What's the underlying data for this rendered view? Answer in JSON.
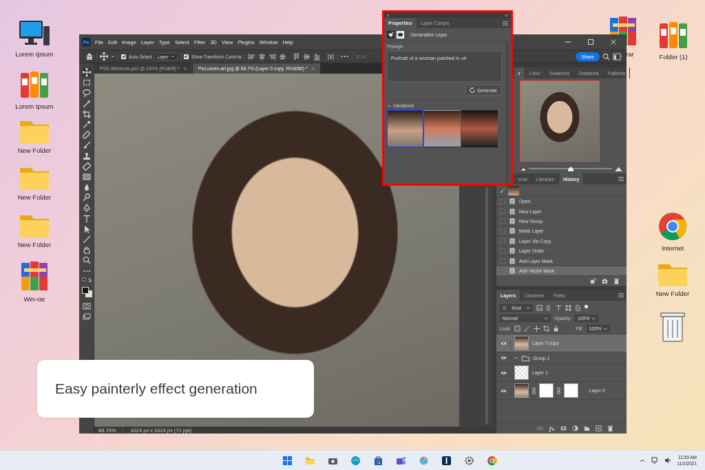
{
  "desktop": {
    "left_icons": [
      {
        "kind": "monitor",
        "label": "Lorem Ipsum"
      },
      {
        "kind": "binders",
        "label": "Lorem Ipsum"
      },
      {
        "kind": "folder",
        "label": "New Folder"
      },
      {
        "kind": "folder",
        "label": "New Folder"
      },
      {
        "kind": "folder",
        "label": "New Folder"
      },
      {
        "kind": "archive",
        "label": "Win-rar"
      }
    ],
    "right_icons": [
      {
        "kind": "archive",
        "label": "rar"
      },
      {
        "kind": "binders",
        "label": "Folder (1)"
      },
      {
        "kind": "browser",
        "label": "Internet"
      },
      {
        "kind": "folder",
        "label": "New Folder"
      },
      {
        "kind": "trash"
      }
    ]
  },
  "photoshop": {
    "app_logo": "Ps",
    "menu": [
      "File",
      "Edit",
      "Image",
      "Layer",
      "Type",
      "Select",
      "Filter",
      "3D",
      "View",
      "Plugins",
      "Window",
      "Help"
    ],
    "options": {
      "auto_select": {
        "label": "Auto-Select",
        "checked": true
      },
      "target": "Layer",
      "transform_controls": {
        "label": "Show Transform Controls",
        "checked": true
      },
      "cut_label": "3D M"
    },
    "share": "Share",
    "doc_tabs": [
      {
        "label": "PSD Windows.psd @ 100% (RGB/8) *",
        "close": "×",
        "selected": false
      },
      {
        "label": "PicLumen-art.jpg @ 88.7% (Layer 0 copy, RGB/8#) *",
        "close": "×",
        "selected": true
      }
    ],
    "status": {
      "zoom": "88.73%",
      "size": "1024 px x 1024 px (72 ppi)"
    },
    "navigator": {
      "tabs": [
        {
          "label": "r",
          "selected": true
        },
        {
          "label": "Color",
          "selected": false
        },
        {
          "label": "Swatches",
          "selected": false
        },
        {
          "label": "Gradients",
          "selected": false
        },
        {
          "label": "Patterns",
          "selected": false
        }
      ],
      "zoom_slider": {
        "level": 0.5
      }
    },
    "history": {
      "tabs": [
        {
          "label": "ents",
          "selected": false
        },
        {
          "label": "Libraries",
          "selected": false
        },
        {
          "label": "History",
          "selected": true
        }
      ],
      "items": [
        {
          "label": "Open",
          "selected": false
        },
        {
          "label": "New Layer",
          "selected": false
        },
        {
          "label": "New Group",
          "selected": false
        },
        {
          "label": "Make Layer",
          "selected": false
        },
        {
          "label": "Layer Via Copy",
          "selected": false
        },
        {
          "label": "Layer Order",
          "selected": false
        },
        {
          "label": "Add Layer Mask",
          "selected": false
        },
        {
          "label": "Add Vector Mask",
          "selected": true
        }
      ]
    },
    "layers": {
      "tabs": [
        {
          "label": "Layers",
          "selected": true
        },
        {
          "label": "Channels",
          "selected": false
        },
        {
          "label": "Paths",
          "selected": false
        }
      ],
      "filter": "Kind",
      "blend_mode": "Normal",
      "opacity_label": "Opacity:",
      "opacity": "100%",
      "lock_label": "Lock:",
      "fill_label": "Fill:",
      "fill": "100%",
      "fx_label": "fx",
      "items": [
        {
          "name": "Layer 0 copy",
          "kind": "image",
          "visible": true,
          "selected": true
        },
        {
          "name": "Group 1",
          "kind": "group",
          "visible": true,
          "selected": false,
          "expanded": true
        },
        {
          "name": "Layer 1",
          "kind": "empty",
          "visible": true,
          "selected": false
        },
        {
          "name": "Layer 0",
          "kind": "masked",
          "visible": true,
          "selected": false
        }
      ]
    }
  },
  "properties": {
    "tabs": [
      {
        "label": "Properties",
        "selected": true
      },
      {
        "label": "Layer Comps",
        "selected": false
      }
    ],
    "layer_type": "Generative Layer",
    "prompt_label": "Prompt:",
    "prompt": "Portrait of a woman painted in oil",
    "generate": "Generate",
    "variations": {
      "label": "Variations",
      "expanded": true,
      "items": [
        {
          "selected": true
        },
        {
          "selected": false
        },
        {
          "selected": false
        }
      ]
    }
  },
  "caption": "Easy painterly effect generation",
  "taskbar": {
    "time": "11:59 AM",
    "date": "11/2/2021"
  }
}
